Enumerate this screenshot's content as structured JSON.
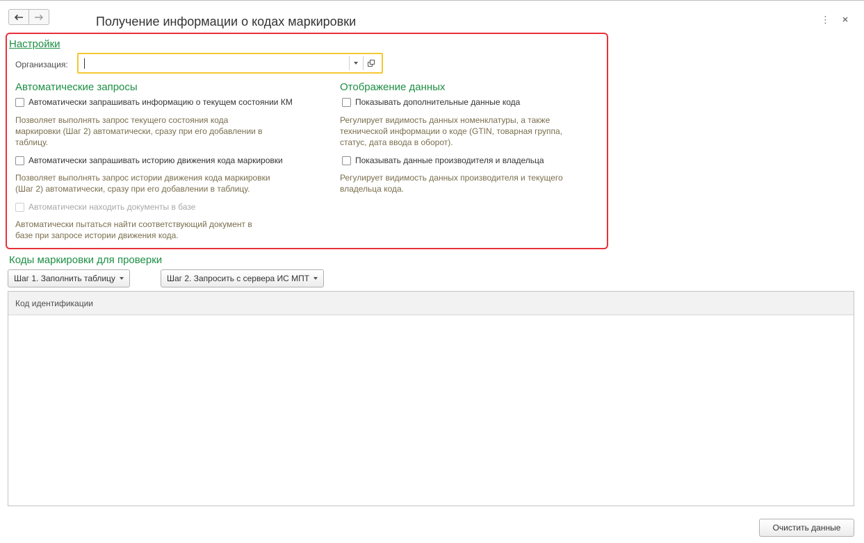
{
  "window": {
    "title": "Получение информации о кодах маркировки",
    "more_icon": "more-vertical-icon",
    "close_icon": "close-icon"
  },
  "settings": {
    "link_title": "Настройки",
    "org_label": "Организация:",
    "org_value": "",
    "auto_requests": {
      "title": "Автоматические запросы",
      "cb_state_label": "Автоматически запрашивать информацию о текущем состоянии КМ",
      "cb_state_desc_1": "Позволяет выполнять запрос текущего состояния кода",
      "cb_state_desc_2": "маркировки (Шаг 2) автоматически, сразу при его добавлении в",
      "cb_state_desc_3": "таблицу.",
      "cb_history_label": "Автоматически запрашивать историю движения кода маркировки",
      "cb_history_desc_1": "Позволяет выполнять запрос истории движения кода маркировки",
      "cb_history_desc_2": "(Шаг 2) автоматически, сразу при его добавлении в таблицу.",
      "cb_docs_label": "Автоматически находить документы в базе",
      "cb_docs_desc_1": "Автоматически пытаться найти соответствующий документ в",
      "cb_docs_desc_2": "базе при запросе истории движения кода."
    },
    "display": {
      "title": "Отображение данных",
      "cb_extra_label": "Показывать дополнительные данные кода",
      "cb_extra_desc_1": "Регулирует видимость данных номенклатуры, а также",
      "cb_extra_desc_2": "технической информации о коде (GTIN, товарная группа,",
      "cb_extra_desc_3": "статус, дата ввода в оборот).",
      "cb_producer_label": "Показывать данные производителя и владельца",
      "cb_producer_desc_1": "Регулирует видимость данных производителя и текущего",
      "cb_producer_desc_2": "владельца кода."
    }
  },
  "codes": {
    "title": "Коды маркировки для проверки",
    "step1_label": "Шаг 1. Заполнить таблицу",
    "step2_label": "Шаг 2. Запросить с сервера ИС МПТ",
    "column_header": "Код идентификации",
    "clear_label": "Очистить данные"
  }
}
